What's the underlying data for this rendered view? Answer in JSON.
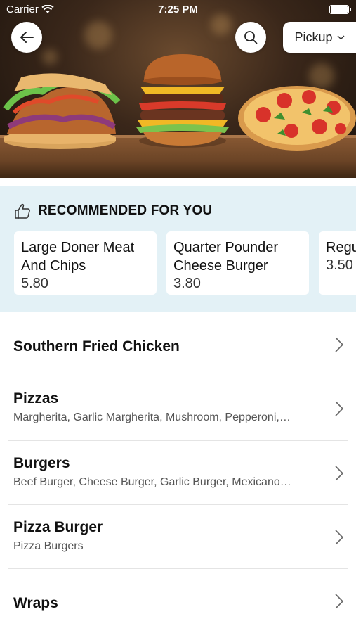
{
  "status_bar": {
    "carrier": "Carrier",
    "time": "7:25 PM"
  },
  "header": {
    "pickup_label": "Pickup"
  },
  "recommended": {
    "title": "RECOMMENDED FOR YOU",
    "items": [
      {
        "name": "Large Doner Meat And Chips",
        "price": "5.80"
      },
      {
        "name": "Quarter Pounder Cheese Burger",
        "price": "3.80"
      },
      {
        "name": "Regular Doner",
        "price": "3.50"
      }
    ]
  },
  "categories": [
    {
      "title": "Southern Fried Chicken",
      "subtitle": ""
    },
    {
      "title": "Pizzas",
      "subtitle": "Margherita, Garlic Margherita, Mushroom, Pepperoni,…"
    },
    {
      "title": "Burgers",
      "subtitle": "Beef Burger, Cheese Burger, Garlic Burger, Mexicano…"
    },
    {
      "title": "Pizza Burger",
      "subtitle": "Pizza Burgers"
    },
    {
      "title": "Wraps",
      "subtitle": ""
    }
  ]
}
